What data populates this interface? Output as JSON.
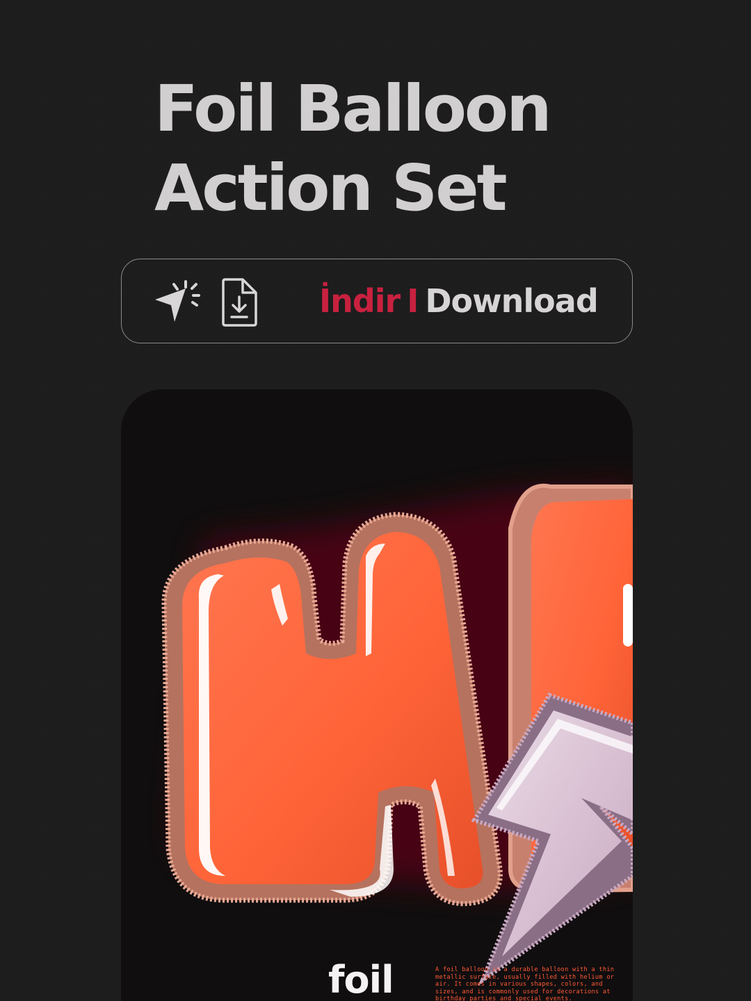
{
  "header": {
    "title_line1": "Foil Balloon",
    "title_line2": "Action Set"
  },
  "download": {
    "label_tr": "İndir",
    "separator": "I",
    "label_en": "Download",
    "icons": [
      "cursor-click-icon",
      "file-download-icon"
    ]
  },
  "preview": {
    "brand": "foil",
    "description": "A foil balloon is a durable balloon with a thin metallic surface, usually filled with helium or air. It comes in various shapes, colors, and sizes, and is commonly used for decorations at birthday parties and special events."
  },
  "colors": {
    "background": "#1c1c1c",
    "title": "#d2cfd0",
    "accent_red": "#c8213f",
    "balloon_orange": "#ff6438",
    "bolt_lilac": "#d9c2d4"
  }
}
